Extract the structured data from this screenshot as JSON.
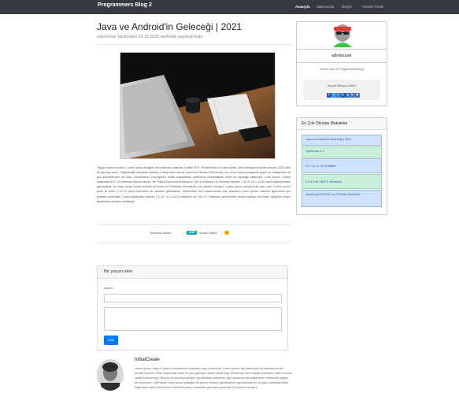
{
  "navbar": {
    "brand": "Programmers Blog 2",
    "links": [
      "Anasayfa",
      "Hakkımızda",
      "İletişim",
      "Yönetim Paneli"
    ]
  },
  "post": {
    "title": "Java ve Android'in Geleceği | 2021",
    "meta": "adminuser tarafından 29.12.2020 tarihinde paylaşılmıştır.",
    "body": "Yaygın inancın tersine, Lorem Ipsum rastgele sözcüklerden oluşmaz. Kökleri M.Ö. 45 tarihinden bu yana klasik Latin edebiyatına kadar uzanan 2000 yıllık bir geçmişi vardır. Virginia'daki Hampden-Sydney College'dan Latince profesörü Richard McClintock, bir Lorem Ipsum pasajında geçen ve anlaşılması en güç sözcüklerden biri olan \"consectetur\" sözcüğünün klasik edebiyattaki örneklerini incelediğinde kesin bir kaynağa ulaşmıştır. Lorm Ipsum, Çiçero tarafından M.Ö. 45 tarihinde kaleme alınan \"de Finibus Bonorum et Malorum\" (İyi ve Kötünün Uç Sınırları) eserinin 1.10.32 ve 1.10.33 sayılı bölümlerinden gelmektedir. Bu kitap, ahlak kuramı üzerine bir tezdir ve Rönesans döneminde çok popüler olmuştur. Lorem Ipsum pasajının ilk satırı olan \"Lorem ipsum dolor sit amet\" 1.10.32 sayılı bölümdeki bir satırdan gelmektedir. 1500'lerden beri kullanılmakta olan standard Lorem Ipsum metinleri ilgilenenler için yeniden üretilmiştir. Çiçero tarafından yazılan 1.10.32 ve 1.10.33 bölümleri de 1914 H. Rackham çevirisinden alınan İngilizce sürümleri eşliğinde özgün biçiminden yeniden üretilmiştir.",
    "views_label": "Okunma Sayısı:",
    "views_count": "1205",
    "comments_label": "Yorum Sayısı:",
    "comments_count": "0"
  },
  "comment_form": {
    "title": "Bir yorum ekle:",
    "name_label": "Adınız",
    "send_label": "Ekle"
  },
  "comments": [
    {
      "author": "InitialCreate",
      "text": "Lorem Ipsum, dizgi ve baskı endüstrisinde kullanılan mıgır metinlerdir. Lorem Ipsum, adı bilinmeyen bir matbaacının bir hurufat numune kitabı oluşturmak üzere bir yazı galerisini alarak karıştırdığı 1500'lerden beri endüstri standardı sahte metinler olarak kullanılmıştır. Beşyüz yıl boyunca varlığını sürdürmekle kalmamış, aynı zamanda pek değişmeden elektronik dizgiye de sıçramıştır. 1960'larda Lorem Ipsum pasajları da içeren Letraset yapraklarının yayınlanması ile ve yakın zamanda Aldus PageMaker gibi Lorem Ipsum sürümleri içeren masaüstü yayıncılık yazılımları ile popüler olmuştur."
    }
  ],
  "sidebar": {
    "profile": {
      "name": "adminuser",
      "description": "Admin User of ProgrammersBlog",
      "social_title": "Sosyal Medya Linkleri",
      "social_icons": [
        "facebook-icon",
        "twitter-icon",
        "instagram-icon",
        "linkedin-icon",
        "github-icon",
        "youtube-icon",
        "website-icon"
      ]
    },
    "popular": {
      "title": "En Çok Okunan Makaleler",
      "items": [
        "Java ve Android'in Geleceği | 2021",
        "Typescript 4.1",
        "C++ 11 ve 18 Yenilikleri",
        "C# 9.0 ve .NET 5 Yenilikleri",
        "JavaScript ES2019 ve ES2020 Yenilikleri"
      ]
    }
  },
  "colors": {
    "navbar": "#343a40",
    "primary": "#007bff",
    "info": "#17a2b8",
    "warning": "#ffc107"
  }
}
